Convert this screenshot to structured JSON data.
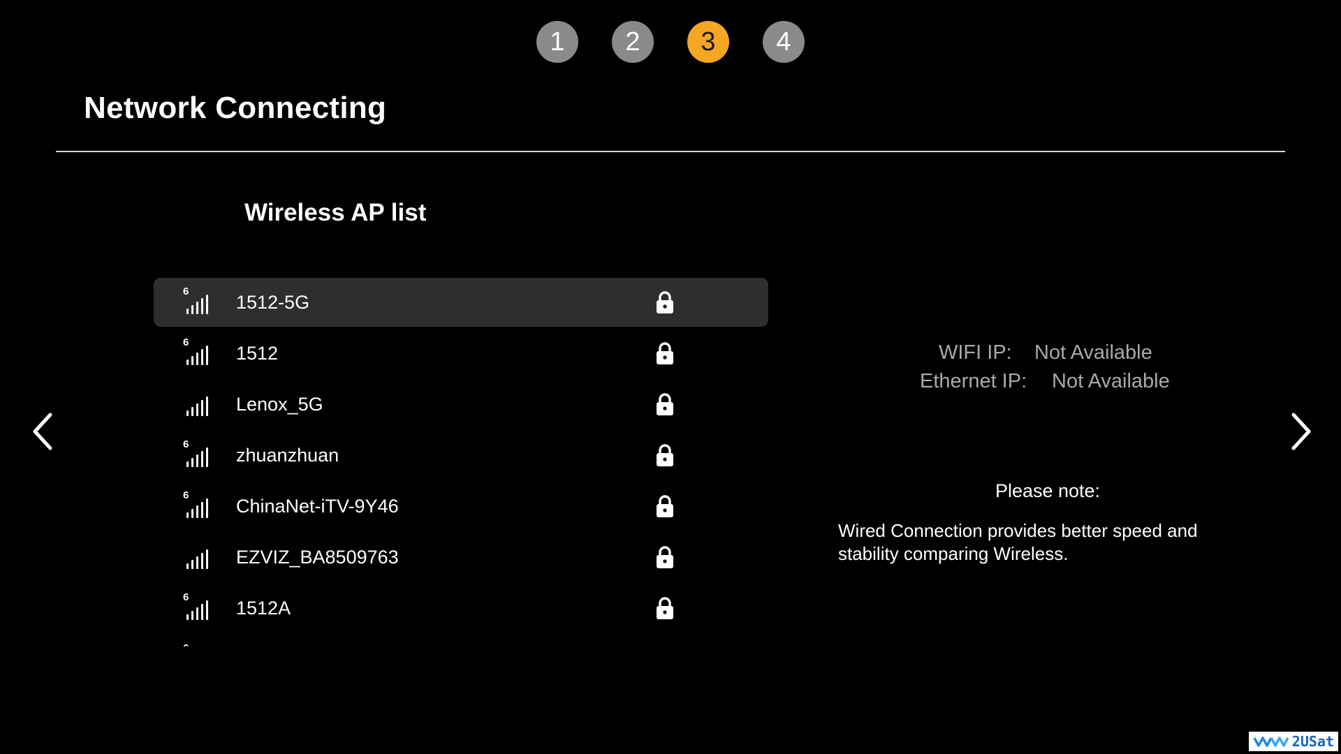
{
  "steps": [
    {
      "label": "1",
      "active": false
    },
    {
      "label": "2",
      "active": false
    },
    {
      "label": "3",
      "active": true
    },
    {
      "label": "4",
      "active": false
    }
  ],
  "page": {
    "title": "Network Connecting",
    "list_heading": "Wireless AP list"
  },
  "access_points": [
    {
      "name": "1512-5G",
      "wifi6": true,
      "secured": true,
      "selected": true
    },
    {
      "name": "1512",
      "wifi6": true,
      "secured": true,
      "selected": false
    },
    {
      "name": "Lenox_5G",
      "wifi6": false,
      "secured": true,
      "selected": false
    },
    {
      "name": "zhuanzhuan",
      "wifi6": true,
      "secured": true,
      "selected": false
    },
    {
      "name": "ChinaNet-iTV-9Y46",
      "wifi6": true,
      "secured": true,
      "selected": false
    },
    {
      "name": "EZVIZ_BA8509763",
      "wifi6": false,
      "secured": true,
      "selected": false
    },
    {
      "name": "1512A",
      "wifi6": true,
      "secured": true,
      "selected": false
    },
    {
      "name": "",
      "wifi6": true,
      "secured": true,
      "selected": false
    }
  ],
  "ip_info": {
    "wifi_label": "WIFI IP:",
    "wifi_value": "Not Available",
    "ethernet_label": "Ethernet IP:",
    "ethernet_value": "Not Available"
  },
  "note": {
    "title": "Please note:",
    "text": "Wired Connection provides better speed and stability comparing Wireless."
  },
  "icons": {
    "prev": "chevron-left-icon",
    "next": "chevron-right-icon",
    "signal": "wifi-signal-icon",
    "lock": "lock-icon"
  },
  "colors": {
    "accent": "#f5a623",
    "step_inactive": "#8a8a8a",
    "selected_row": "#2e2e2e",
    "muted_text": "#a9a9a9"
  },
  "watermark": {
    "text": "2USat"
  }
}
